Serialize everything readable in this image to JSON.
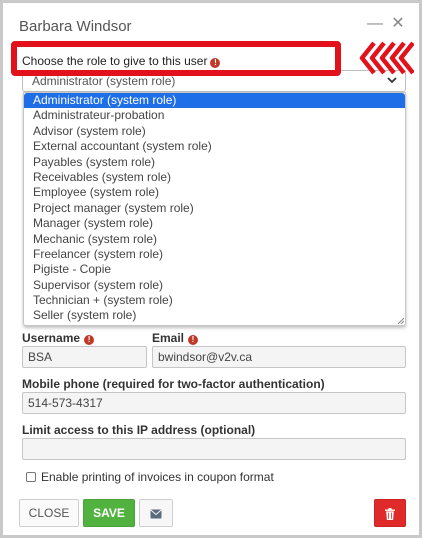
{
  "dialog": {
    "title": "Barbara Windsor",
    "minimize_glyph": "—",
    "close_glyph": "✕"
  },
  "role": {
    "prompt": "Choose the role to give to this user",
    "selected_value": "Administrator (system role)",
    "options": [
      "Administrator (system role)",
      "Administrateur-probation",
      "Advisor (system role)",
      "External accountant (system role)",
      "Payables (system role)",
      "Receivables (system role)",
      "Employee (system role)",
      "Project manager (system role)",
      "Manager (system role)",
      "Mechanic (system role)",
      "Freelancer (system role)",
      "Pigiste - Copie",
      "Supervisor (system role)",
      "Technician + (system role)",
      "Seller (system role)"
    ],
    "highlight_color": "#1e6ee8",
    "annotation_color": "#e3111b"
  },
  "form": {
    "username_label": "Username",
    "username_value": "BSA",
    "email_label": "Email",
    "email_value": "bwindsor@v2v.ca",
    "mobile_label": "Mobile phone (required for two-factor authentication)",
    "mobile_value": "514-573-4317",
    "ip_label": "Limit access to this IP address (optional)",
    "ip_value": "",
    "coupon_label": "Enable printing of invoices in coupon format",
    "required_glyph": "!"
  },
  "buttons": {
    "close_label": "CLOSE",
    "save_label": "SAVE",
    "save_color": "#52b240",
    "delete_color": "#e02a2a",
    "mail_icon": "envelope-icon",
    "delete_icon": "trash-icon"
  }
}
